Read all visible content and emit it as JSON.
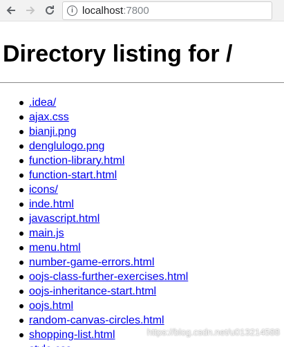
{
  "browser": {
    "url_host": "localhost",
    "url_port": ":7800"
  },
  "page": {
    "title": "Directory listing for /",
    "files": [
      ".idea/",
      "ajax.css",
      "bianji.png",
      "denglulogo.png",
      "function-library.html",
      "function-start.html",
      "icons/",
      "inde.html",
      "javascript.html",
      "main.js",
      "menu.html",
      "number-game-errors.html",
      "oojs-class-further-exercises.html",
      "oojs-inheritance-start.html",
      "oojs.html",
      "random-canvas-circles.html",
      "shopping-list.html",
      "style.css"
    ]
  },
  "watermark": "https://blog.csdn.net/u013214588",
  "colors": {
    "link": "#0000ee",
    "toolbar_bg": "#f2f2f2"
  }
}
